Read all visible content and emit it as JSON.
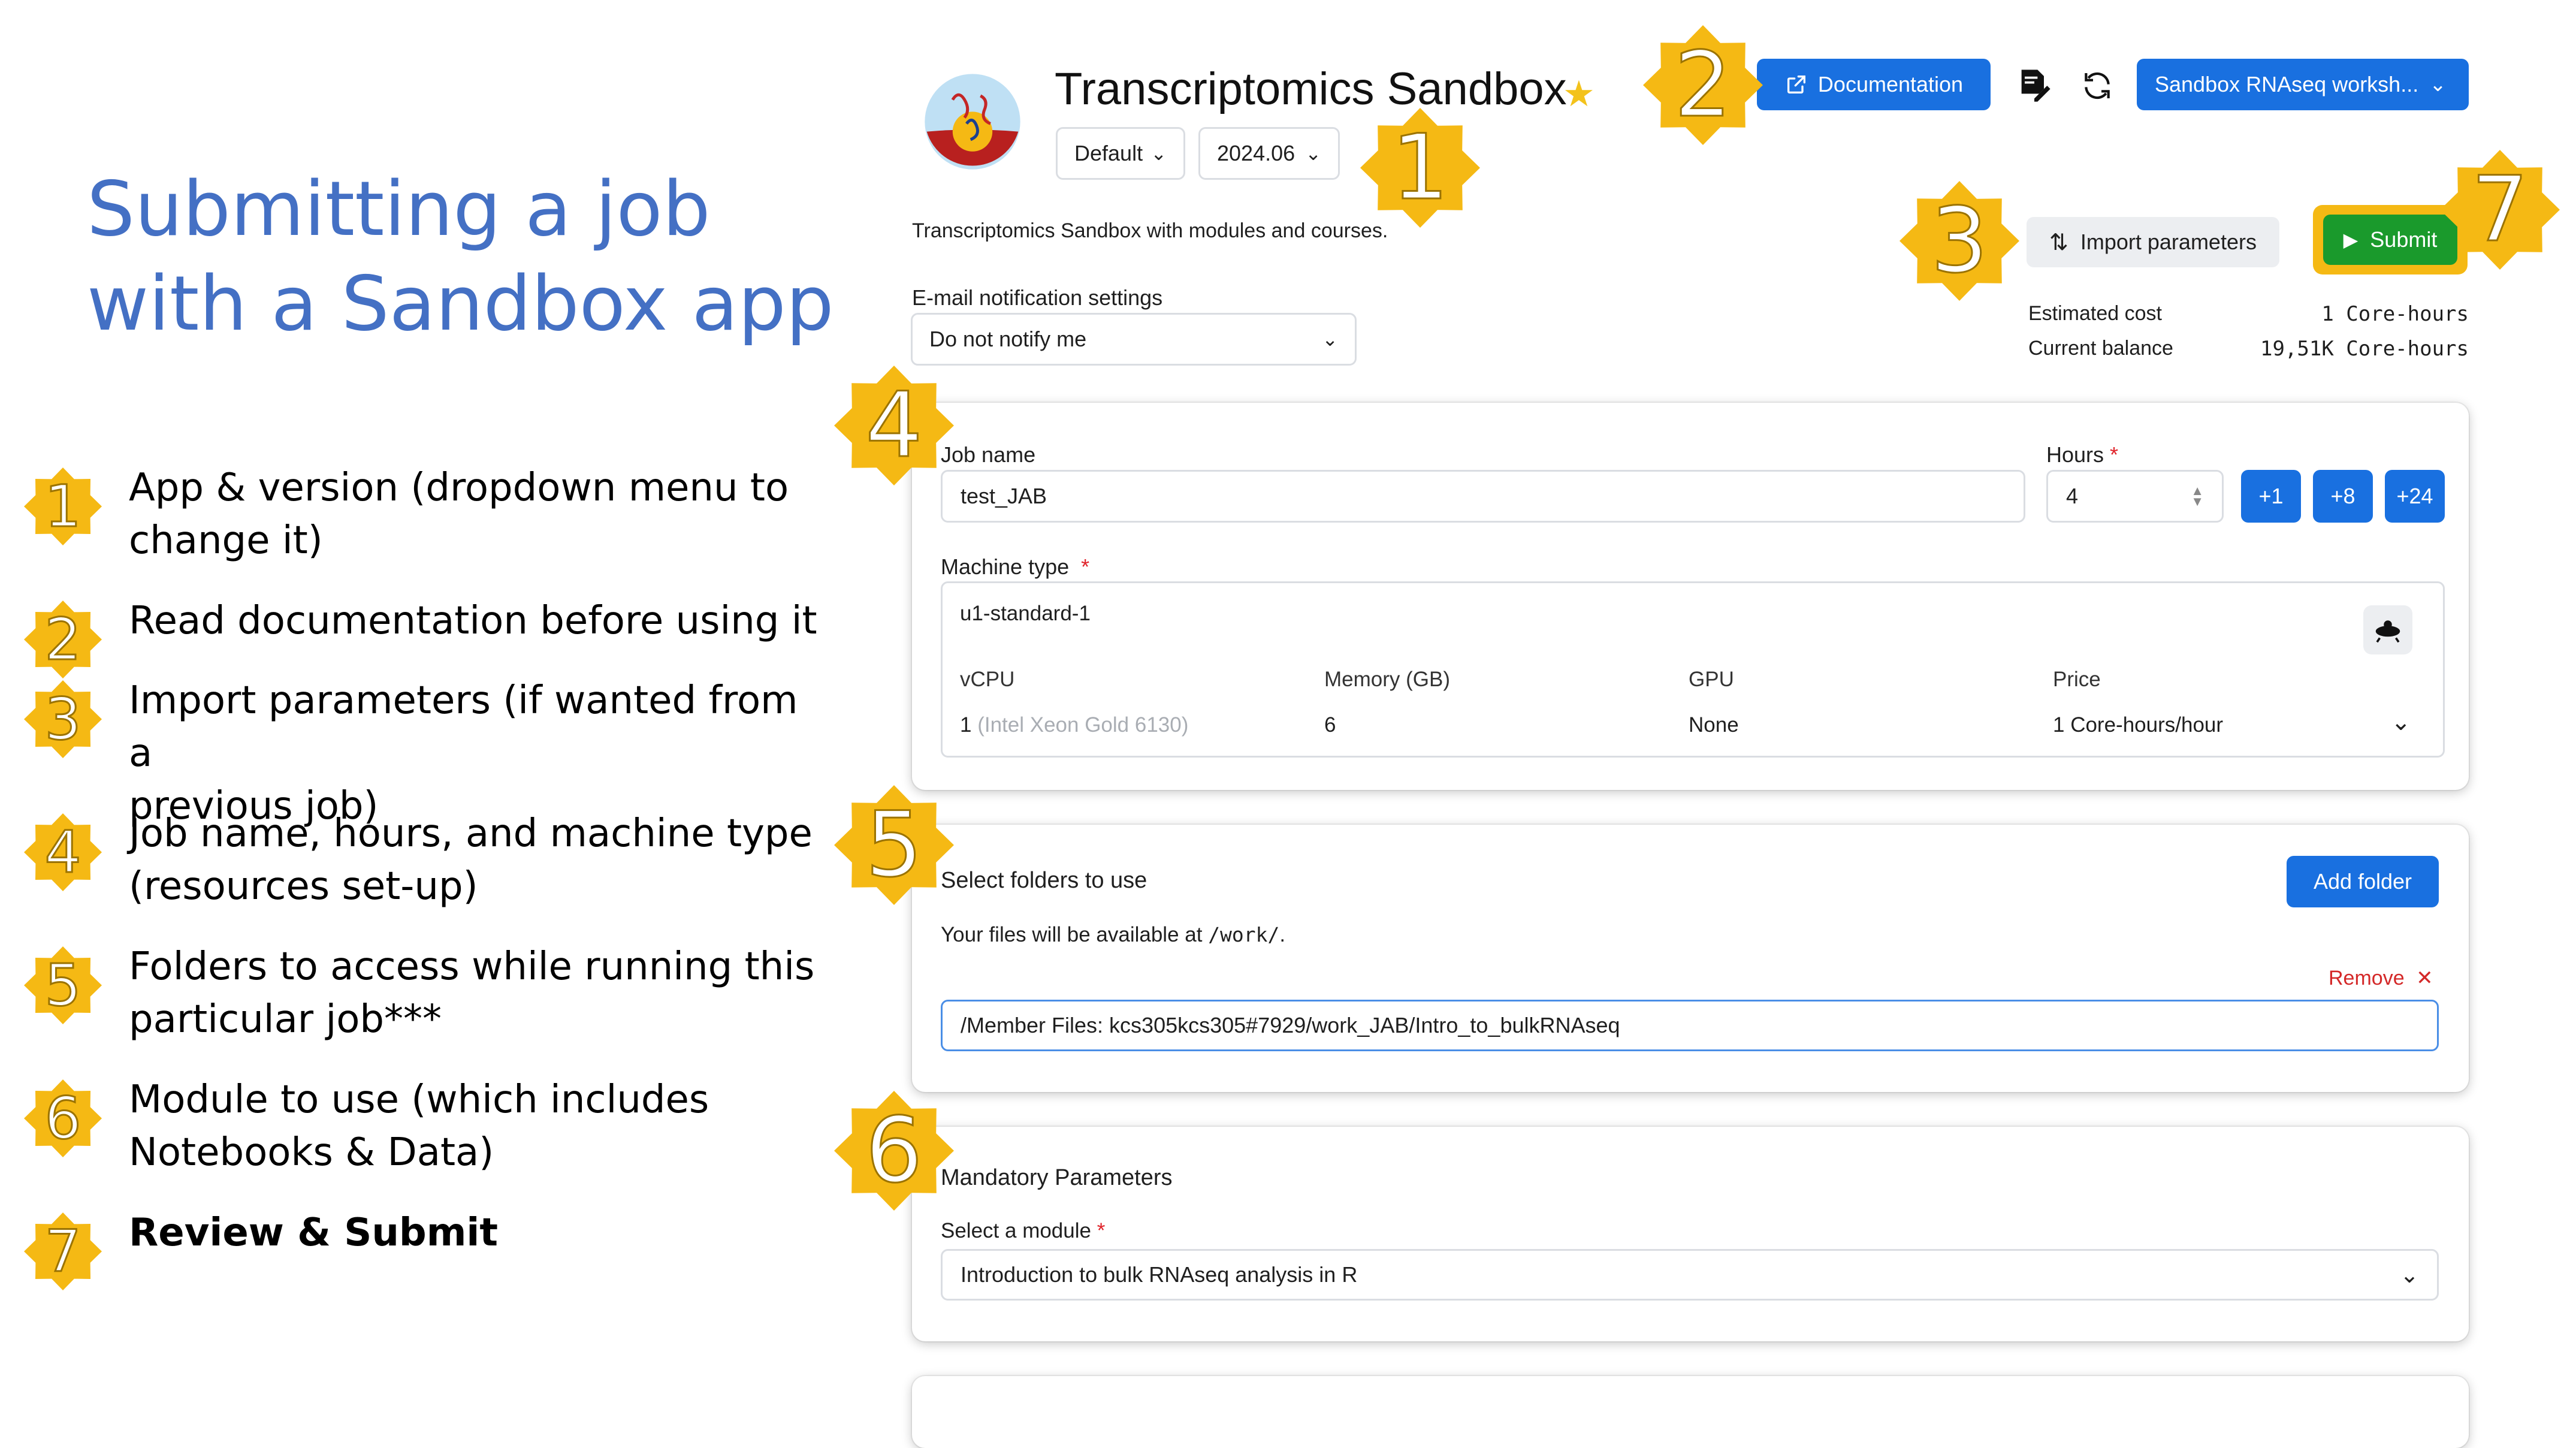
{
  "slide": {
    "title_line1": "Submitting a job",
    "title_line2": "with a Sandbox app",
    "steps": [
      {
        "num": "1",
        "text_line1": "App & version (dropdown menu to",
        "text_line2": "change it)"
      },
      {
        "num": "2",
        "text_line1": "Read documentation before using it",
        "text_line2": ""
      },
      {
        "num": "3",
        "text_line1": "Import parameters (if wanted from a",
        "text_line2": "previous job)"
      },
      {
        "num": "4",
        "text_line1": "Job name, hours, and machine type",
        "text_line2": "(resources set-up)"
      },
      {
        "num": "5",
        "text_line1": "Folders to access while running this",
        "text_line2": "particular job***"
      },
      {
        "num": "6",
        "text_line1": "Module to use (which includes",
        "text_line2": "Notebooks & Data)"
      },
      {
        "num": "7",
        "text_line1": "Review & Submit",
        "text_line2": ""
      }
    ]
  },
  "colors": {
    "badge_gold": "#f5b914",
    "primary": "#1970e0",
    "submit_green": "#1a9a2c",
    "accent_title": "#4470c4"
  },
  "app": {
    "title": "Transcriptomics Sandbox",
    "favorite_icon": "star-icon",
    "flavor": "Default",
    "version": "2024.06",
    "description": "Transcriptomics Sandbox with modules and courses.",
    "documentation_label": "Documentation",
    "project_selector": "Sandbox RNAseq worksh...",
    "import_label": "Import parameters",
    "submit_label": "Submit",
    "estimated_cost_label": "Estimated cost",
    "estimated_cost_value": "1 Core-hours",
    "current_balance_label": "Current balance",
    "current_balance_value": "19,51K Core-hours",
    "email_label": "E-mail notification settings",
    "email_value": "Do not notify me"
  },
  "job": {
    "name_label": "Job name",
    "name_value": "test_JAB",
    "hours_label": "Hours",
    "hours_value": "4",
    "hour_buttons": [
      "+1",
      "+8",
      "+24"
    ],
    "machine_label": "Machine type",
    "machine_value": "u1-standard-1",
    "cols": {
      "vcpu": "vCPU",
      "memory": "Memory (GB)",
      "gpu": "GPU",
      "price": "Price"
    },
    "vcpu_value": "1",
    "vcpu_detail": "(Intel Xeon Gold 6130)",
    "memory_value": "6",
    "gpu_value": "None",
    "price_value": "1 Core-hours/hour"
  },
  "folders": {
    "heading": "Select folders to use",
    "add_label": "Add folder",
    "info_prefix": "Your files will be available at ",
    "info_path": "/work/",
    "info_suffix": ".",
    "remove_label": "Remove",
    "folder_path": "/Member Files: kcs305kcs305#7929/work_JAB/Intro_to_bulkRNAseq"
  },
  "params": {
    "heading": "Mandatory Parameters",
    "module_label": "Select a module",
    "module_value": "Introduction to bulk RNAseq analysis in R"
  }
}
